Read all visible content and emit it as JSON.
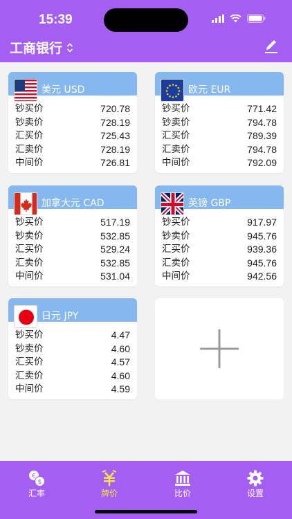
{
  "status": {
    "time": "15:39"
  },
  "header": {
    "bank_name": "工商银行"
  },
  "labels": {
    "cash_buy": "钞买价",
    "cash_sell": "钞卖价",
    "spot_buy": "汇买价",
    "spot_sell": "汇卖价",
    "middle": "中间价"
  },
  "cards": [
    {
      "flag": "us-flag-icon",
      "name": "美元 USD",
      "cash_buy": "720.78",
      "cash_sell": "728.19",
      "spot_buy": "725.43",
      "spot_sell": "728.19",
      "middle": "726.81"
    },
    {
      "flag": "eu-flag-icon",
      "name": "欧元 EUR",
      "cash_buy": "771.42",
      "cash_sell": "794.78",
      "spot_buy": "789.39",
      "spot_sell": "794.78",
      "middle": "792.09"
    },
    {
      "flag": "ca-flag-icon",
      "name": "加拿大元 CAD",
      "cash_buy": "517.19",
      "cash_sell": "532.85",
      "spot_buy": "529.24",
      "spot_sell": "532.85",
      "middle": "531.04"
    },
    {
      "flag": "uk-flag-icon",
      "name": "英镑 GBP",
      "cash_buy": "917.97",
      "cash_sell": "945.76",
      "spot_buy": "939.36",
      "spot_sell": "945.76",
      "middle": "942.56"
    },
    {
      "flag": "jp-flag-icon",
      "name": "日元 JPY",
      "cash_buy": "4.47",
      "cash_sell": "4.60",
      "spot_buy": "4.57",
      "spot_sell": "4.60",
      "middle": "4.59"
    }
  ],
  "tabs": [
    {
      "label": "汇率",
      "icon": "exchange-icon"
    },
    {
      "label": "牌价",
      "icon": "yuan-icon",
      "active": true
    },
    {
      "label": "比价",
      "icon": "bank-icon"
    },
    {
      "label": "设置",
      "icon": "gear-icon"
    }
  ],
  "colors": {
    "purple": "#a45ef2",
    "card_header": "#85b8ee",
    "active_tab": "#f5e34a"
  }
}
